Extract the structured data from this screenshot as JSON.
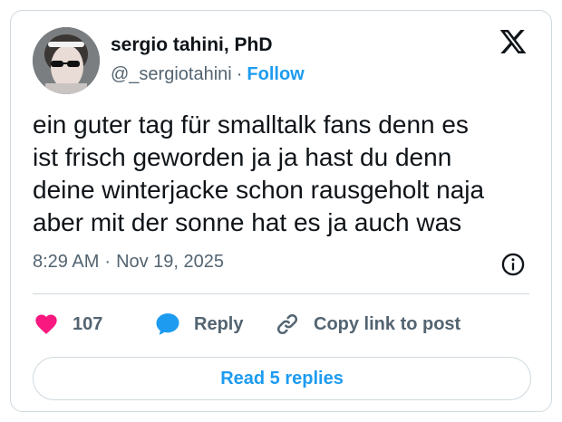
{
  "author": {
    "display_name": "sergio tahini, PhD",
    "handle": "@_sergiotahini",
    "separator": "·",
    "follow_label": "Follow"
  },
  "tweet": {
    "lines": [
      "ein guter tag für smalltalk fans denn es",
      "ist frisch geworden ja ja hast du denn",
      "deine winterjacke schon rausgeholt naja",
      "aber mit der sonne hat es ja auch was"
    ],
    "time": "8:29 AM",
    "separator": "·",
    "date": "Nov 19, 2025"
  },
  "actions": {
    "likes": "107",
    "reply_label": "Reply",
    "copy_link_label": "Copy link to post"
  },
  "replies_button": "Read 5 replies",
  "colors": {
    "accent": "#1d9bf0",
    "heart": "#f91880",
    "text": "#0f1419",
    "muted": "#536471",
    "border": "#cfd9de"
  },
  "icons": [
    "x-logo-icon",
    "info-icon",
    "heart-icon",
    "reply-bubble-icon",
    "link-icon"
  ]
}
